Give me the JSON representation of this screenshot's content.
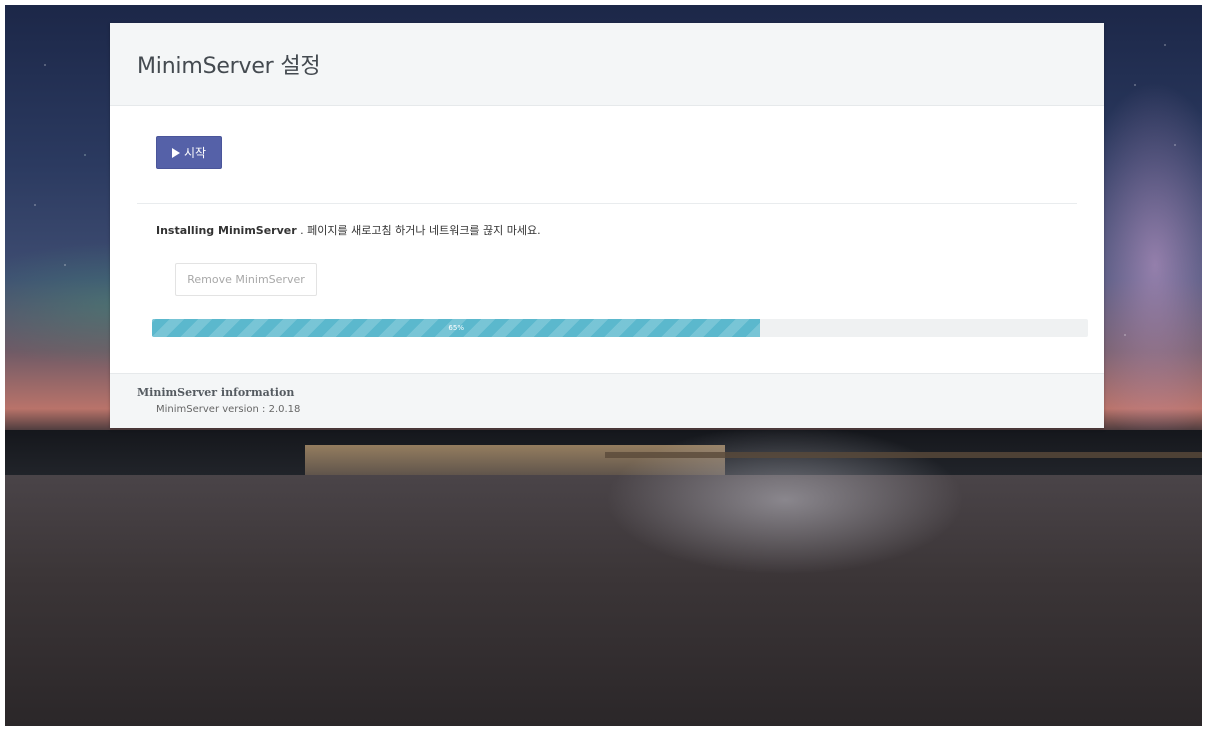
{
  "panel": {
    "title": "MinimServer 설정"
  },
  "actions": {
    "start_label": "시작",
    "remove_label": "Remove MinimServer"
  },
  "status": {
    "installing_name": "Installing MinimServer",
    "installing_message": " . 페이지를 새로고침 하거나 네트워크를 끊지 마세요."
  },
  "progress": {
    "percent": 65,
    "label": "65%",
    "color": "#5bb8cd"
  },
  "info": {
    "title": "MinimServer information",
    "version_text": "MinimServer version : 2.0.18"
  },
  "colors": {
    "primary_button": "#5561a8",
    "header_bg": "#f4f6f7"
  },
  "icons": {
    "start": "play-icon"
  }
}
